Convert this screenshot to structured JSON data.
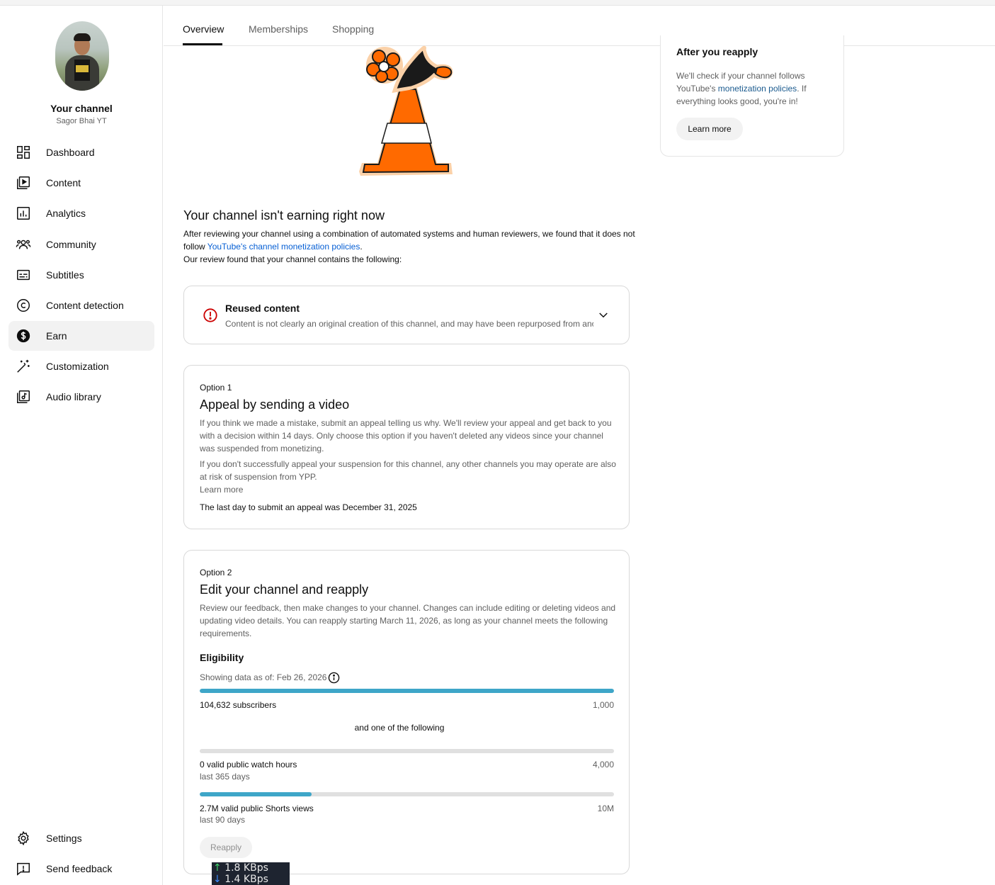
{
  "sidebar": {
    "channel_title": "Your channel",
    "channel_handle": "Sagor Bhai YT",
    "items": [
      {
        "label": "Dashboard",
        "icon": "dashboard-icon"
      },
      {
        "label": "Content",
        "icon": "content-icon"
      },
      {
        "label": "Analytics",
        "icon": "analytics-icon"
      },
      {
        "label": "Community",
        "icon": "community-icon"
      },
      {
        "label": "Subtitles",
        "icon": "subtitles-icon"
      },
      {
        "label": "Content detection",
        "icon": "copyright-icon"
      },
      {
        "label": "Earn",
        "icon": "dollar-icon",
        "active": true
      },
      {
        "label": "Customization",
        "icon": "magic-wand-icon"
      },
      {
        "label": "Audio library",
        "icon": "audio-library-icon"
      }
    ],
    "bottom_items": [
      {
        "label": "Settings",
        "icon": "gear-icon"
      },
      {
        "label": "Send feedback",
        "icon": "feedback-icon"
      }
    ]
  },
  "tabs": [
    "Overview",
    "Memberships",
    "Shopping"
  ],
  "main": {
    "heading": "Your channel isn't earning right now",
    "para_before_link": "After reviewing your channel using a combination of automated systems and human reviewers, we found that it does not follow ",
    "para_link": "YouTube's channel monetization policies",
    "para_after_link": ".",
    "para_line2": "Our review found that your channel contains the following:",
    "reused": {
      "title": "Reused content",
      "desc": "Content is not clearly an original creation of this channel, and may have been repurposed from anoth"
    },
    "option1": {
      "label": "Option 1",
      "title": "Appeal by sending a video",
      "text1": "If you think we made a mistake, submit an appeal telling us why. We'll review your appeal and get back to you with a decision within 14 days. Only choose this option if you haven't deleted any videos since your channel was suspended from monetizing.",
      "text2": "If you don't successfully appeal your suspension for this channel, any other channels you may operate are also at risk of suspension from YPP.",
      "learn_more": "Learn more",
      "deadline": "The last day to submit an appeal was December 31, 2025"
    },
    "option2": {
      "label": "Option 2",
      "title": "Edit your channel and reapply",
      "text": "Review our feedback, then make changes to your channel. Changes can include editing or deleting videos and updating video details. You can reapply starting March 11, 2026, as long as your channel meets the following requirements.",
      "eligibility_title": "Eligibility",
      "showing_data": "Showing data as of: Feb 26, 2026",
      "and_one": "and one of the following",
      "metrics": [
        {
          "label": "104,632 subscribers",
          "target": "1,000",
          "progress": 1.0,
          "sub": ""
        },
        {
          "label": "0 valid public watch hours",
          "target": "4,000",
          "progress": 0.0,
          "sub": "last 365 days"
        },
        {
          "label": "2.7M valid public Shorts views",
          "target": "10M",
          "progress": 0.27,
          "sub": "last 90 days"
        }
      ],
      "reapply": "Reapply"
    }
  },
  "side_card": {
    "title": "After you reapply",
    "text_before": "We'll check if your channel follows YouTube's ",
    "link": "monetization policies",
    "text_after": ". If everything looks good, you're in!",
    "button": "Learn more"
  },
  "netspeed": {
    "up": "1.8 KBps",
    "down": "1.4 KBps"
  },
  "colors": {
    "accent_link": "#065fd4",
    "progress_fill": "#3ea6c8",
    "warning": "#cc0000",
    "cone_orange": "#ff6a00"
  }
}
